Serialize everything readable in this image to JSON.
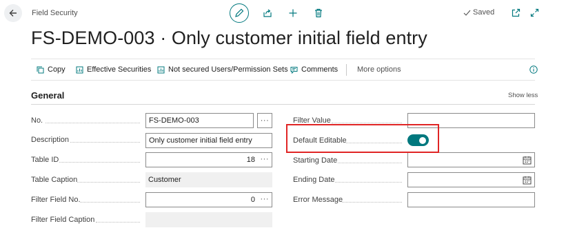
{
  "header": {
    "breadcrumb": "Field Security",
    "saved_status": "Saved",
    "title": "FS-DEMO-003 · Only customer initial field entry"
  },
  "icons": {
    "back": "arrow-left-icon",
    "edit": "pencil-icon",
    "share": "share-icon",
    "new": "plus-icon",
    "delete": "trash-icon",
    "saved": "checkmark-icon",
    "open_new_window": "open-in-new-window-icon",
    "expand": "expand-icon",
    "info": "info-icon",
    "lookup": "ellipsis-icon",
    "calendar": "calendar-icon"
  },
  "actions": {
    "copy": "Copy",
    "effective_securities": "Effective Securities",
    "not_secured": "Not secured Users/Permission Sets",
    "comments": "Comments",
    "more_options": "More options"
  },
  "section": {
    "title": "General",
    "show_less": "Show less"
  },
  "fields": {
    "no": {
      "label": "No.",
      "value": "FS-DEMO-003",
      "lookup": "···"
    },
    "description": {
      "label": "Description",
      "value": "Only customer initial field entry"
    },
    "table_id": {
      "label": "Table ID",
      "value": "18",
      "lookup": "···"
    },
    "table_caption": {
      "label": "Table Caption",
      "value": "Customer"
    },
    "filter_field_no": {
      "label": "Filter Field No.",
      "value": "0",
      "lookup": "···"
    },
    "filter_field_caption": {
      "label": "Filter Field Caption",
      "value": ""
    },
    "filter_value": {
      "label": "Filter Value",
      "value": ""
    },
    "default_editable": {
      "label": "Default Editable",
      "value": true
    },
    "starting_date": {
      "label": "Starting Date",
      "value": ""
    },
    "ending_date": {
      "label": "Ending Date",
      "value": ""
    },
    "error_message": {
      "label": "Error Message",
      "value": ""
    }
  },
  "colors": {
    "accent": "#00787e",
    "highlight_box": "#e02424",
    "readonly_bg": "#f0f0f0"
  }
}
